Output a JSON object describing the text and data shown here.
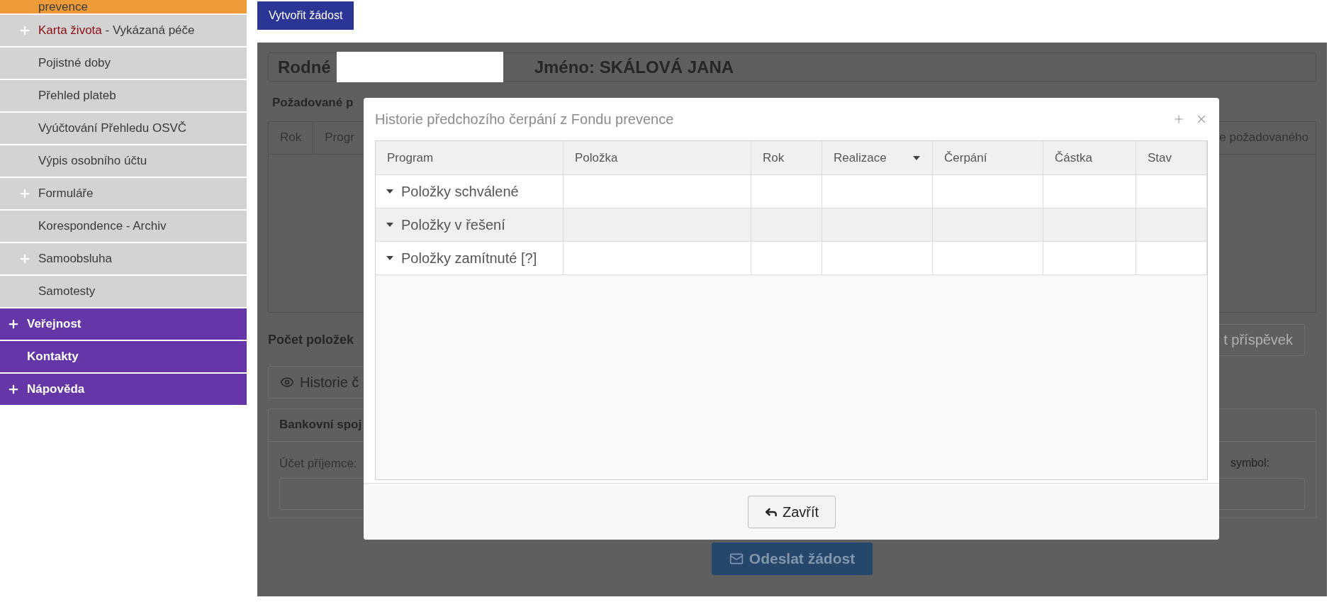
{
  "sidebar": {
    "items": [
      {
        "kind": "active",
        "label": "prevence",
        "expandable": false
      },
      {
        "kind": "item",
        "highlight": "Karta života",
        "label": "- Vykázaná péče",
        "expandable": true
      },
      {
        "kind": "item",
        "label": "Pojistné doby",
        "expandable": false
      },
      {
        "kind": "item",
        "label": "Přehled plateb",
        "expandable": false
      },
      {
        "kind": "item",
        "label": "Vyúčtování Přehledu OSVČ",
        "expandable": false
      },
      {
        "kind": "item",
        "label": "Výpis osobního účtu",
        "expandable": false
      },
      {
        "kind": "item",
        "label": "Formuláře",
        "expandable": true
      },
      {
        "kind": "item",
        "label": "Korespondence - Archiv",
        "expandable": false
      },
      {
        "kind": "item",
        "label": "Samoobsluha",
        "expandable": true
      },
      {
        "kind": "item",
        "label": "Samotesty",
        "expandable": false
      },
      {
        "kind": "group",
        "label": "Veřejnost",
        "expandable": true
      },
      {
        "kind": "group",
        "label": "Kontakty",
        "expandable": false
      },
      {
        "kind": "group",
        "label": "Nápověda",
        "expandable": true
      }
    ]
  },
  "create_button": "Vytvořit žádost",
  "form": {
    "name_label": "Rodné",
    "name_value": "Jméno: SKÁLOVÁ JANA",
    "section_title": "Požadované p",
    "table_columns": [
      "Rok",
      "Progr"
    ],
    "table_column_right": "e požadovaného",
    "count_label": "Počet položek",
    "contribution_button": "t příspěvek",
    "history_button": "Historie č",
    "bank_title": "Bankovní spoj",
    "account_label": "Účet příjemce:",
    "symbol_label": "symbol:",
    "submit_button": "Odeslat žádost"
  },
  "dialog": {
    "title": "Historie předchozího čerpání z Fondu prevence",
    "columns": [
      {
        "label": "Program",
        "sorted": false
      },
      {
        "label": "Položka",
        "sorted": false
      },
      {
        "label": "Rok",
        "sorted": false
      },
      {
        "label": "Realizace",
        "sorted": true
      },
      {
        "label": "Čerpání",
        "sorted": false
      },
      {
        "label": "Částka",
        "sorted": false
      },
      {
        "label": "Stav",
        "sorted": false
      }
    ],
    "groups": [
      {
        "label": "Položky schválené",
        "expanded": true
      },
      {
        "label": "Položky v řešení",
        "expanded": true
      },
      {
        "label": "Položky zamítnuté [?]",
        "expanded": true
      }
    ],
    "close_button": "Zavřít"
  }
}
